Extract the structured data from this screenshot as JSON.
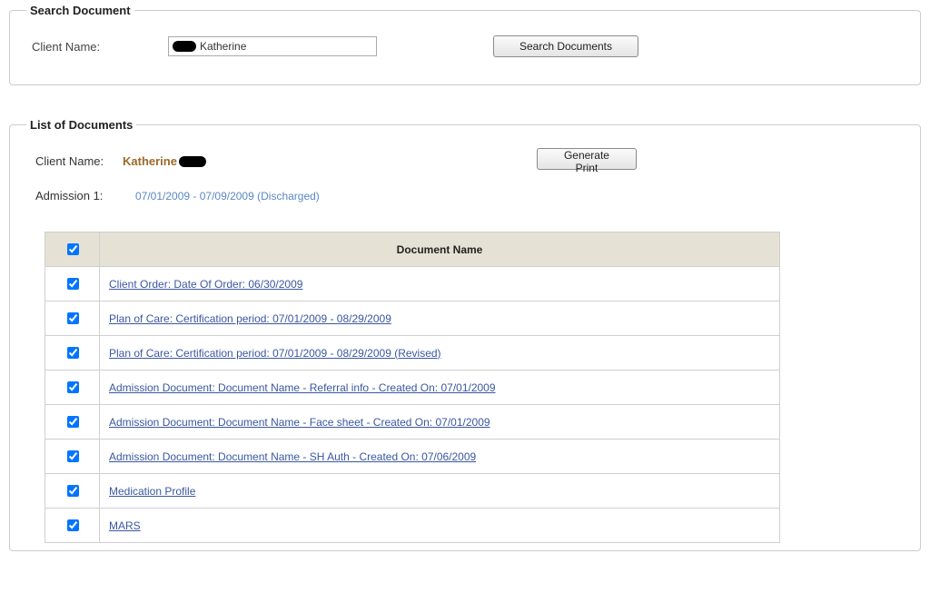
{
  "search": {
    "legend": "Search Document",
    "client_name_label": "Client Name:",
    "client_name_value": "Katherine",
    "search_button": "Search Documents"
  },
  "list": {
    "legend": "List of Documents",
    "client_name_label": "Client Name:",
    "client_name_value": "Katherine",
    "generate_print_button": "Generate Print",
    "admission_label": "Admission 1:",
    "admission_value": "07/01/2009 - 07/09/2009 (Discharged)",
    "table": {
      "header_checkbox_checked": true,
      "header_doc_name": "Document Name",
      "rows": [
        {
          "checked": true,
          "name": "Client Order: Date Of Order: 06/30/2009"
        },
        {
          "checked": true,
          "name": "Plan of Care: Certification period: 07/01/2009 - 08/29/2009"
        },
        {
          "checked": true,
          "name": "Plan of Care: Certification period: 07/01/2009 - 08/29/2009 (Revised)"
        },
        {
          "checked": true,
          "name": "Admission Document: Document Name - Referral info - Created On: 07/01/2009"
        },
        {
          "checked": true,
          "name": "Admission Document: Document Name - Face sheet - Created On: 07/01/2009"
        },
        {
          "checked": true,
          "name": "Admission Document: Document Name - SH Auth - Created On: 07/06/2009"
        },
        {
          "checked": true,
          "name": "Medication Profile"
        },
        {
          "checked": true,
          "name": "MARS"
        }
      ]
    }
  }
}
